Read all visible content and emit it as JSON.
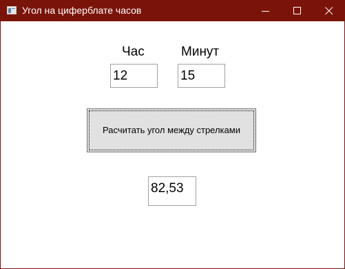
{
  "window": {
    "title": "Угол на циферблате часов",
    "titlebar_color": "#7a1409",
    "controls": [
      "minimize-icon",
      "maximize-icon",
      "close-icon"
    ]
  },
  "form": {
    "hour_label": "Час",
    "minute_label": "Минут",
    "hour_value": "12",
    "minute_value": "15",
    "calculate_button_label": "Расчитать угол между стрелками",
    "result_value": "82,53"
  }
}
